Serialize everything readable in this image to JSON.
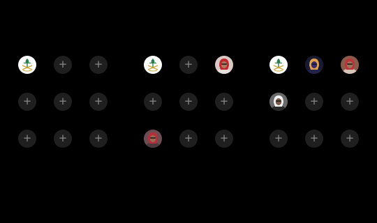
{
  "add_glyph": "+",
  "grids": [
    {
      "slots": [
        {
          "kind": "emblem",
          "icon": "saudi-emblem-icon"
        },
        {
          "kind": "empty",
          "icon": "plus-icon"
        },
        {
          "kind": "empty",
          "icon": "plus-icon"
        },
        {
          "kind": "empty",
          "icon": "plus-icon"
        },
        {
          "kind": "empty",
          "icon": "plus-icon"
        },
        {
          "kind": "empty",
          "icon": "plus-icon"
        },
        {
          "kind": "empty",
          "icon": "plus-icon"
        },
        {
          "kind": "empty",
          "icon": "plus-icon"
        },
        {
          "kind": "empty",
          "icon": "plus-icon"
        }
      ]
    },
    {
      "slots": [
        {
          "kind": "emblem",
          "icon": "saudi-emblem-icon"
        },
        {
          "kind": "empty",
          "icon": "plus-icon"
        },
        {
          "kind": "avatar",
          "icon": "avatar-red-headdress"
        },
        {
          "kind": "empty",
          "icon": "plus-icon"
        },
        {
          "kind": "empty",
          "icon": "plus-icon"
        },
        {
          "kind": "empty",
          "icon": "plus-icon"
        },
        {
          "kind": "avatar",
          "icon": "avatar-red-headdress-2"
        },
        {
          "kind": "empty",
          "icon": "plus-icon"
        },
        {
          "kind": "empty",
          "icon": "plus-icon"
        }
      ]
    },
    {
      "slots": [
        {
          "kind": "emblem",
          "icon": "saudi-emblem-icon"
        },
        {
          "kind": "avatar",
          "icon": "avatar-dark-photo"
        },
        {
          "kind": "avatar",
          "icon": "avatar-red-headdress-3"
        },
        {
          "kind": "avatar",
          "icon": "avatar-white-headdress"
        },
        {
          "kind": "empty",
          "icon": "plus-icon"
        },
        {
          "kind": "empty",
          "icon": "plus-icon"
        },
        {
          "kind": "empty",
          "icon": "plus-icon"
        },
        {
          "kind": "empty",
          "icon": "plus-icon"
        },
        {
          "kind": "empty",
          "icon": "plus-icon"
        }
      ]
    }
  ],
  "colors": {
    "background": "#000000",
    "empty_slot": "#1f1f1f",
    "plus": "#8a8a8a",
    "emblem_green": "#2e7d4f",
    "emblem_gold": "#c9a43a"
  }
}
